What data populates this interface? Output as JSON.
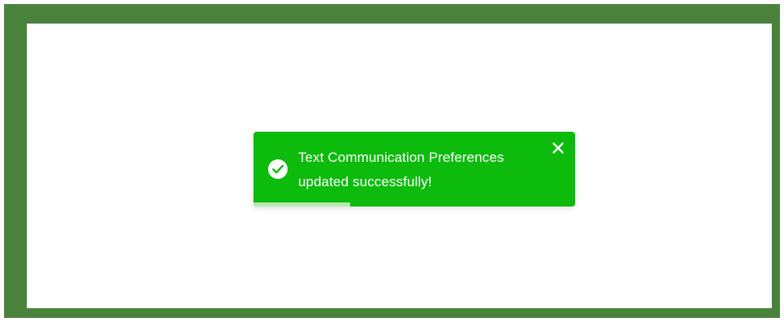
{
  "toast": {
    "message_line1": "Text Communication Preferences",
    "message_line2": "updated successfully!",
    "status_icon": "check-circle-icon",
    "close_icon": "close-icon",
    "progress_fraction": 0.3
  },
  "colors": {
    "frame": "#4a823b",
    "toast_background": "#0dbb0d",
    "toast_text": "#ffffff",
    "progress_fill": "#b8e9b5",
    "progress_track": "#0dbb0d"
  }
}
